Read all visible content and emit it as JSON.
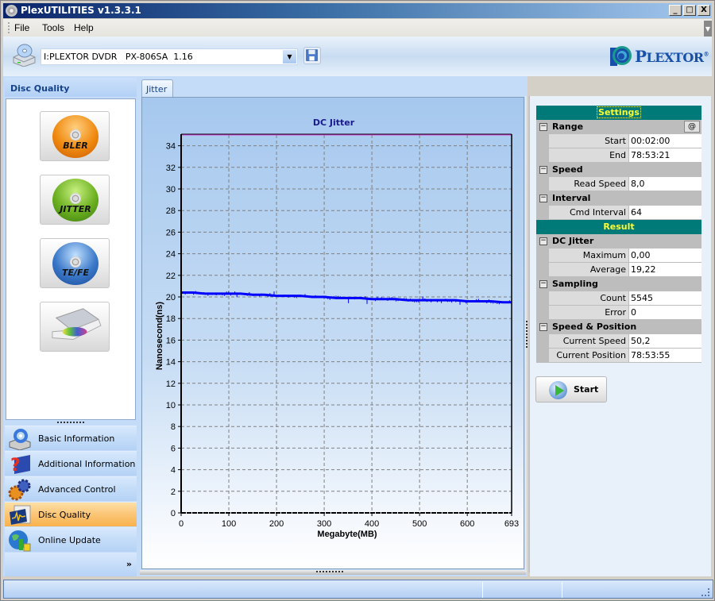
{
  "window": {
    "title": "PlexUTILITIES v1.3.3.1",
    "controls": {
      "minimize": "_",
      "maximize": "□",
      "close": "X"
    }
  },
  "menu": {
    "items": [
      "File",
      "Tools",
      "Help"
    ]
  },
  "toolbar": {
    "drive_selected": "I:PLEXTOR DVDR   PX-806SA  1.16",
    "drive_icon": "optical-drive-icon",
    "save_icon": "floppy-disk-icon",
    "logo_text_big": "P",
    "logo_text_rest": "LEXTOR",
    "logo_reg": "®"
  },
  "left_panel": {
    "header": "Disc Quality",
    "tools": [
      {
        "label": "BLER",
        "icon": "bler-disc-icon",
        "color": "#f08a10"
      },
      {
        "label": "JITTER",
        "icon": "jitter-disc-icon",
        "color": "#6cb020"
      },
      {
        "label": "TE/FE",
        "icon": "tefe-disc-icon",
        "color": "#3a78c8"
      },
      {
        "label": "",
        "icon": "drive-tray-icon",
        "color": "#cccccc"
      }
    ],
    "nav": [
      {
        "label": "Basic Information",
        "icon": "disc-drive-icon",
        "active": false
      },
      {
        "label": "Additional Information",
        "icon": "help-book-icon",
        "active": false
      },
      {
        "label": "Advanced Control",
        "icon": "gears-icon",
        "active": false
      },
      {
        "label": "Disc Quality",
        "icon": "monitor-waveform-icon",
        "active": true
      },
      {
        "label": "Online Update",
        "icon": "globe-update-icon",
        "active": false
      }
    ],
    "more_glyph": "»"
  },
  "center": {
    "tab_label": "Jitter"
  },
  "chart_data": {
    "type": "line",
    "title": "DC Jitter",
    "xlabel": "Megabyte(MB)",
    "ylabel": "Nanosecond(ns)",
    "xlim": [
      0,
      693
    ],
    "ylim": [
      0,
      35
    ],
    "x_ticks": [
      0,
      100,
      200,
      300,
      400,
      500,
      600,
      693
    ],
    "y_ticks": [
      0,
      2,
      4,
      6,
      8,
      10,
      12,
      14,
      16,
      18,
      20,
      22,
      24,
      26,
      28,
      30,
      32,
      34
    ],
    "grid": true,
    "series": [
      {
        "name": "DC Jitter",
        "color": "#0000ff",
        "x": [
          0,
          25,
          50,
          75,
          100,
          125,
          150,
          175,
          200,
          225,
          250,
          275,
          300,
          325,
          350,
          375,
          400,
          425,
          450,
          475,
          500,
          525,
          550,
          575,
          600,
          625,
          650,
          675,
          693
        ],
        "y": [
          20.4,
          20.4,
          20.3,
          20.3,
          20.3,
          20.3,
          20.2,
          20.2,
          20.1,
          20.1,
          20.1,
          20.0,
          20.0,
          19.9,
          19.9,
          19.9,
          19.8,
          19.8,
          19.8,
          19.7,
          19.7,
          19.7,
          19.7,
          19.7,
          19.6,
          19.6,
          19.6,
          19.5,
          19.5
        ]
      }
    ]
  },
  "right_panel": {
    "settings_title": "Settings",
    "result_title": "Result",
    "range": {
      "group": "Range",
      "at_button": "@",
      "rows": [
        {
          "key": "Start",
          "value": "00:02:00"
        },
        {
          "key": "End",
          "value": "78:53:21"
        }
      ]
    },
    "speed": {
      "group": "Speed",
      "rows": [
        {
          "key": "Read Speed",
          "value": "8,0"
        }
      ]
    },
    "interval": {
      "group": "Interval",
      "rows": [
        {
          "key": "Cmd Interval",
          "value": "64"
        }
      ]
    },
    "dc_jitter": {
      "group": "DC Jitter",
      "rows": [
        {
          "key": "Maximum",
          "value": "0,00"
        },
        {
          "key": "Average",
          "value": "19,22"
        }
      ]
    },
    "sampling": {
      "group": "Sampling",
      "rows": [
        {
          "key": "Count",
          "value": "5545"
        },
        {
          "key": "Error",
          "value": "0"
        }
      ]
    },
    "speed_position": {
      "group": "Speed & Position",
      "rows": [
        {
          "key": "Current Speed",
          "value": "50,2"
        },
        {
          "key": "Current Position",
          "value": "78:53:55"
        }
      ]
    },
    "start_button": "Start",
    "toggle_glyph": "−"
  },
  "colors": {
    "section_header_bg": "#007a78",
    "section_header_text": "#ffff33",
    "active_nav": "#fbc576",
    "series": "#0000ff"
  }
}
